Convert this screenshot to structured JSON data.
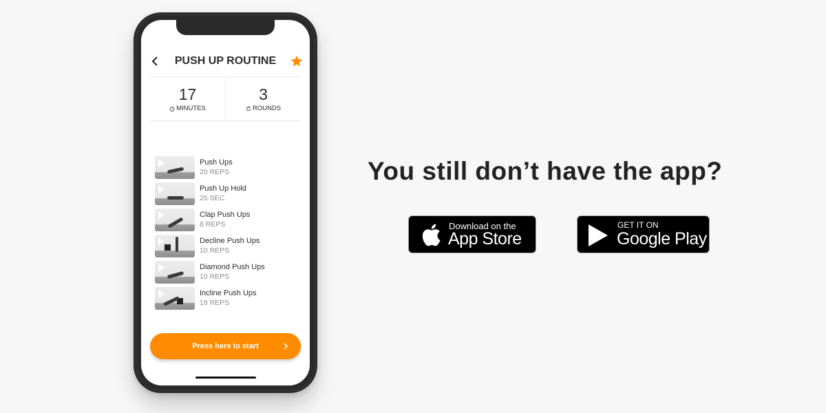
{
  "colors": {
    "accent": "#ff8c00",
    "background": "#f7f7f7",
    "text_primary": "#2b2b2b",
    "text_secondary": "#8a8a8a"
  },
  "phone": {
    "header": {
      "back_icon": "chevron-left-icon",
      "title": "PUSH UP ROUTINE",
      "favorite_icon": "star-icon"
    },
    "stats": [
      {
        "value": "17",
        "label": "MINUTES",
        "icon": "stopwatch-icon"
      },
      {
        "value": "3",
        "label": "ROUNDS",
        "icon": "refresh-icon"
      }
    ],
    "exercises": [
      {
        "name": "Push Ups",
        "detail": "20 REPS"
      },
      {
        "name": "Push Up Hold",
        "detail": "25 SEC"
      },
      {
        "name": "Clap Push Ups",
        "detail": "8 REPS"
      },
      {
        "name": "Decline Push Ups",
        "detail": "10 REPS"
      },
      {
        "name": "Diamond Push Ups",
        "detail": "10 REPS"
      },
      {
        "name": "Incline Push Ups",
        "detail": "18 REPS"
      }
    ],
    "start_button": {
      "label": "Press here to start",
      "icon": "chevron-right-icon"
    }
  },
  "promo": {
    "headline": "You still don’t have the app?",
    "app_store": {
      "small": "Download on the",
      "big": "App Store",
      "icon": "apple-icon"
    },
    "google_play": {
      "small": "GET IT ON",
      "big": "Google Play",
      "icon": "play-icon"
    }
  }
}
